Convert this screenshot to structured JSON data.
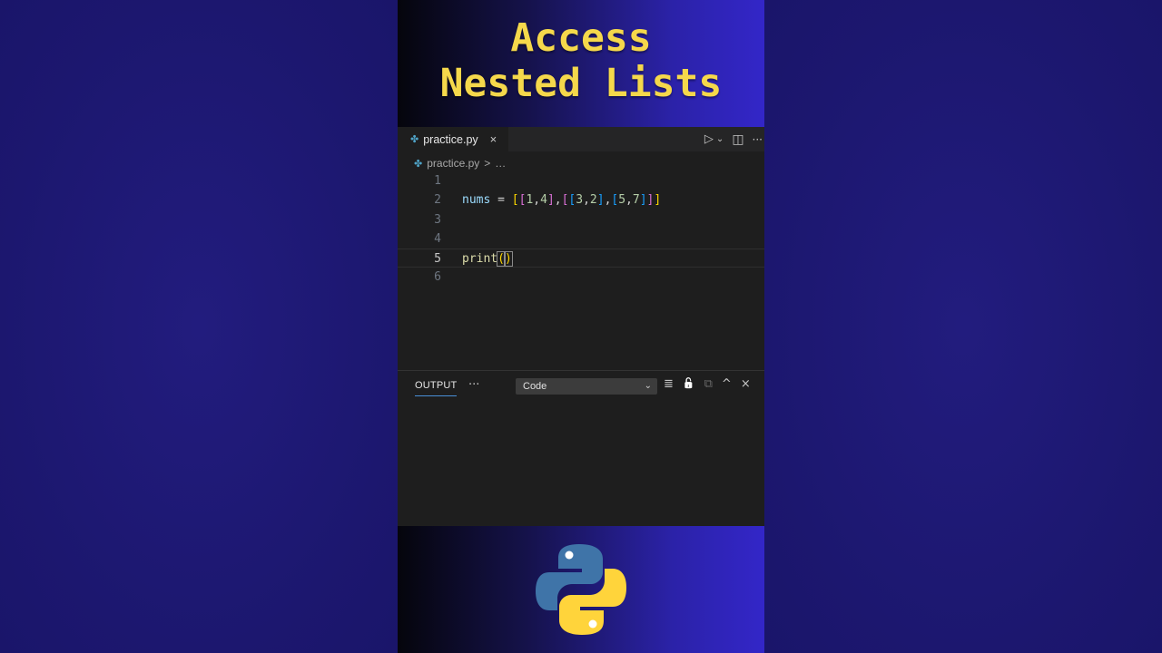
{
  "title": {
    "line1": "Access",
    "line2": "Nested Lists"
  },
  "editor": {
    "tab_name": "practice.py",
    "tab_close": "×",
    "breadcrumb_file": "practice.py",
    "breadcrumb_sep": ">",
    "breadcrumb_more": "…",
    "actions": {
      "run": "▷",
      "run_menu": "⌄",
      "split": "◫",
      "more": "···"
    },
    "lines": [
      {
        "num": "1",
        "text": ""
      },
      {
        "num": "2",
        "text": "nums = [[1,4],[[3,2],[5,7]]]"
      },
      {
        "num": "3",
        "text": ""
      },
      {
        "num": "4",
        "text": ""
      },
      {
        "num": "5",
        "text": "print()"
      },
      {
        "num": "6",
        "text": ""
      }
    ]
  },
  "panel": {
    "tab_label": "OUTPUT",
    "more": "···",
    "channel": "Code",
    "chevron": "⌄",
    "actions": {
      "clear": "≣",
      "lock": "🔓",
      "copy": "⧉",
      "maximize": "^",
      "close": "×"
    }
  },
  "colors": {
    "title": "#f5d84b",
    "background": "#1f1a78",
    "editor_bg": "#1e1e1e",
    "bracket_gold": "#ffd700",
    "bracket_violet": "#da70d6",
    "bracket_blue": "#179fff",
    "python_blue": "#3f74a8",
    "python_yellow": "#ffd43b"
  }
}
